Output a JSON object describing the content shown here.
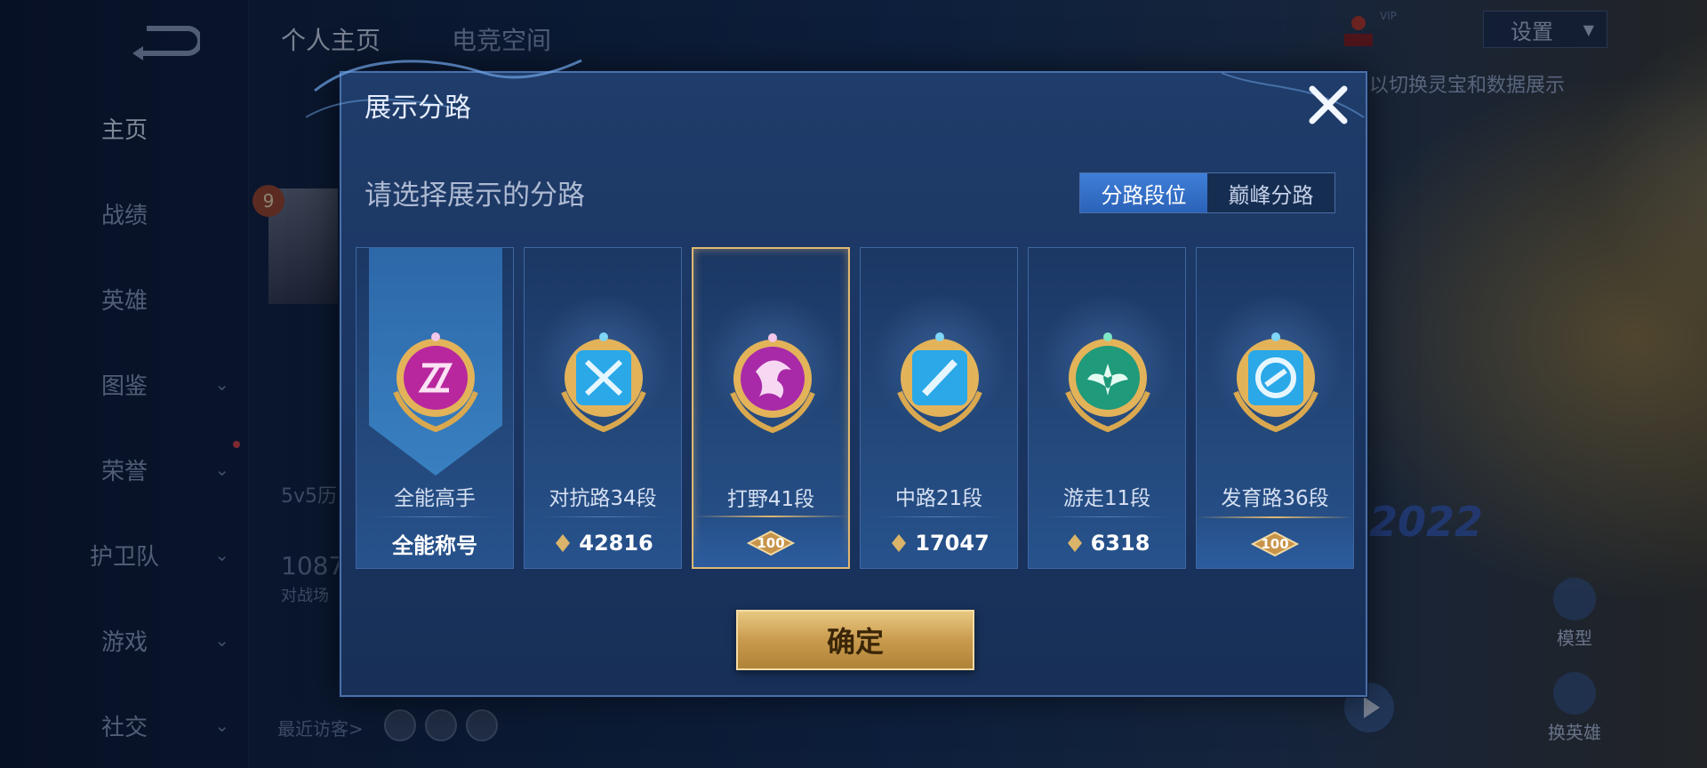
{
  "sidebar": {
    "items": [
      {
        "label": "主页"
      },
      {
        "label": "战绩"
      },
      {
        "label": "英雄"
      },
      {
        "label": "图鉴"
      },
      {
        "label": "荣誉"
      },
      {
        "label": "护卫队"
      },
      {
        "label": "游戏"
      },
      {
        "label": "社交"
      }
    ]
  },
  "top_tabs": [
    {
      "label": "个人主页"
    },
    {
      "label": "电竞空间"
    }
  ],
  "header": {
    "settings_label": "设置",
    "vip_text": "VIP",
    "hint": "以切换灵宝和数据展示"
  },
  "background": {
    "level": "9",
    "history_label": "5v5历",
    "count": "1087",
    "count_label": "对战场",
    "recent_visitors": "最近访客>",
    "year": "2022",
    "model_label": "模型",
    "change_hero_label": "换英雄"
  },
  "modal": {
    "title": "展示分路",
    "subtitle": "请选择展示的分路",
    "segments": [
      {
        "label": "分路段位",
        "active": true
      },
      {
        "label": "巅峰分路",
        "active": false
      }
    ],
    "cards": [
      {
        "label": "全能高手",
        "value": "全能称号",
        "icon": "allround-emblem-icon",
        "selected": false
      },
      {
        "label": "对抗路34段",
        "value": "42816",
        "icon": "clash-lane-emblem-icon",
        "selected": false
      },
      {
        "label": "打野41段",
        "value": "100",
        "icon": "jungle-emblem-icon",
        "selected": true
      },
      {
        "label": "中路21段",
        "value": "17047",
        "icon": "mid-lane-emblem-icon",
        "selected": false
      },
      {
        "label": "游走11段",
        "value": "6318",
        "icon": "roam-emblem-icon",
        "selected": false
      },
      {
        "label": "发育路36段",
        "value": "100",
        "icon": "farm-lane-emblem-icon",
        "selected": false
      }
    ],
    "confirm_label": "确定"
  },
  "colors": {
    "accent_gold": "#e0b872",
    "segment_active": "#3f7fd8",
    "modal_bg": "#1f3c6a"
  }
}
